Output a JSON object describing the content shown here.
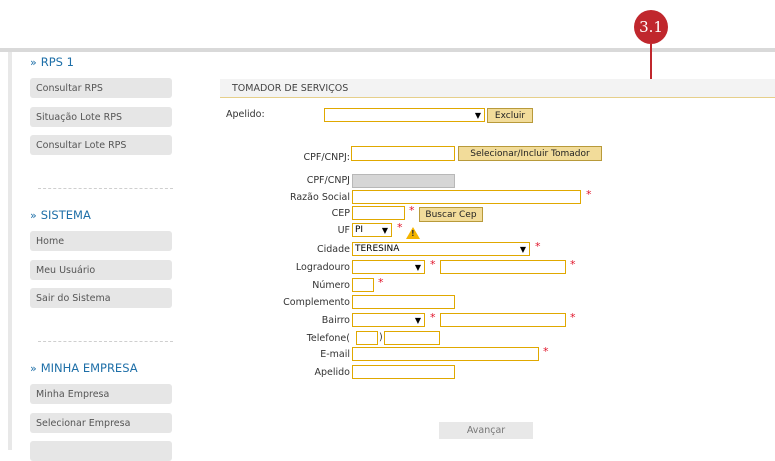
{
  "annotation": {
    "badge": "3.1"
  },
  "sidebar": {
    "sections": [
      {
        "title": "RPS 1",
        "items": [
          "Consultar RPS",
          "Situação Lote RPS",
          "Consultar Lote RPS"
        ]
      },
      {
        "title": "SISTEMA",
        "items": [
          "Home",
          "Meu Usuário",
          "Sair do Sistema"
        ]
      },
      {
        "title": "MINHA EMPRESA",
        "items": [
          "Minha Empresa",
          "Selecionar Empresa"
        ]
      }
    ]
  },
  "main": {
    "panel_title": "TOMADOR DE SERVIÇOS",
    "apelido_label": "Apelido:",
    "excluir_label": "Excluir",
    "cpf_cnpj_label": "CPF/CNPJ:",
    "selecionar_label": "Selecionar/Incluir Tomador",
    "form": {
      "cpf_cnpj": "CPF/CNPJ",
      "razao_social": "Razão Social",
      "cep": "CEP",
      "buscar_cep": "Buscar Cep",
      "uf": "UF",
      "uf_value": "PI",
      "cidade": "Cidade",
      "cidade_value": "TERESINA",
      "logradouro": "Logradouro",
      "numero": "Número",
      "complemento": "Complemento",
      "bairro": "Bairro",
      "telefone": "Telefone",
      "email": "E-mail",
      "apelido": "Apelido",
      "required_mark": "*"
    },
    "avancar_label": "Avançar"
  }
}
